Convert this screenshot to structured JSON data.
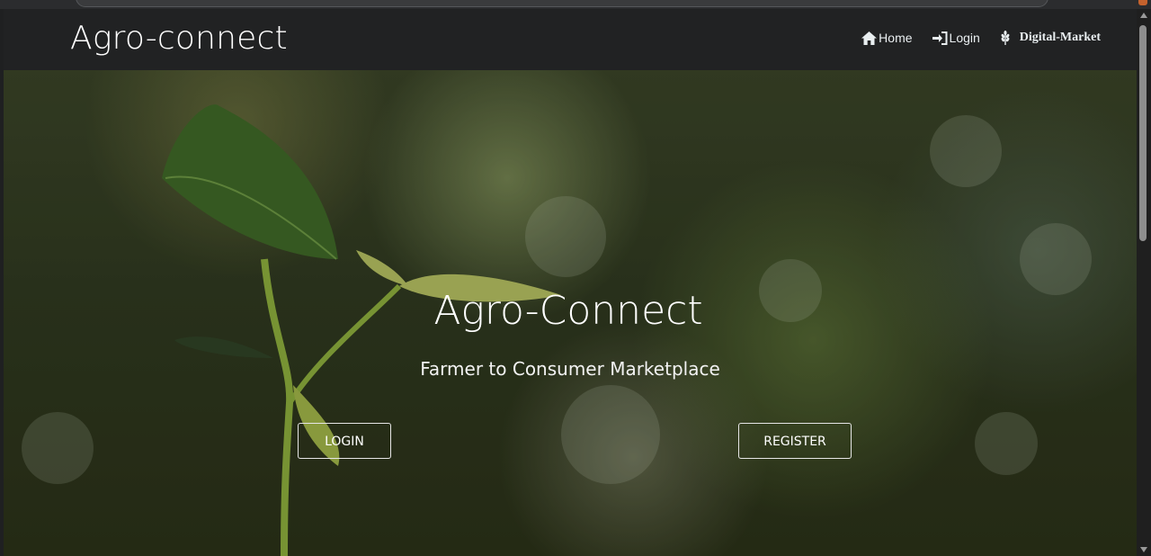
{
  "navbar": {
    "brand": "Agro-connect",
    "links": [
      {
        "label": "Home",
        "icon": "home-icon"
      },
      {
        "label": "Login",
        "icon": "login-icon"
      },
      {
        "label": "Digital-Market",
        "icon": "wheat-icon"
      }
    ]
  },
  "hero": {
    "title": "Agro-Connect",
    "subtitle": "Farmer to Consumer Marketplace",
    "login_button": "LOGIN",
    "register_button": "REGISTER"
  },
  "colors": {
    "navbar_bg": "#212223",
    "text": "#ffffff",
    "leaf_green": "#4f7a2e"
  }
}
